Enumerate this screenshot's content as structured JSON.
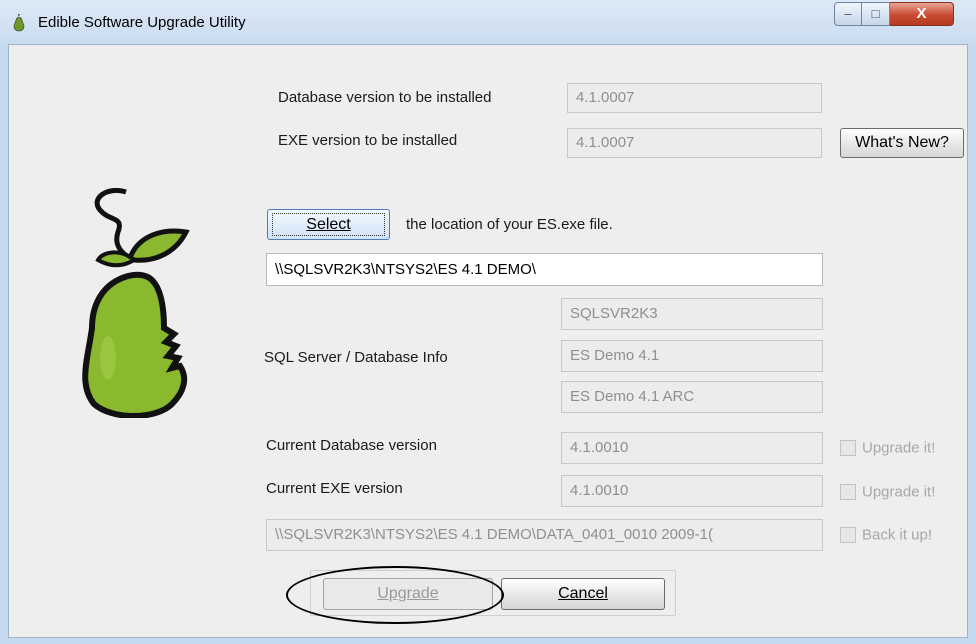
{
  "window": {
    "title": "Edible Software Upgrade Utility",
    "controls": {
      "minimize": "–",
      "maximize": "□",
      "close": "X"
    }
  },
  "versions": {
    "db_install_label": "Database version to be installed",
    "db_install_value": "4.1.0007",
    "exe_install_label": "EXE version to be installed",
    "exe_install_value": "4.1.0007",
    "whats_new_label": "What's New?"
  },
  "location": {
    "select_label": "Select",
    "select_hint": "the location of your ES.exe file.",
    "path_value": "\\\\SQLSVR2K3\\NTSYS2\\ES 4.1 DEMO\\"
  },
  "sql": {
    "label": "SQL Server / Database Info",
    "server": "SQLSVR2K3",
    "database": "ES Demo 4.1",
    "archive": "ES Demo 4.1 ARC"
  },
  "current": {
    "db_label": "Current Database version",
    "db_value": "4.1.0010",
    "db_check": "Upgrade it!",
    "exe_label": "Current EXE version",
    "exe_value": "4.1.0010",
    "exe_check": "Upgrade it!",
    "backup_path": "\\\\SQLSVR2K3\\NTSYS2\\ES 4.1 DEMO\\DATA_0401_0010 2009-1(",
    "backup_check": "Back it up!"
  },
  "buttons": {
    "upgrade": "Upgrade",
    "cancel": "Cancel"
  },
  "colors": {
    "pear_green": "#8ab82f",
    "window_frame": "#c4d8ee",
    "close_red": "#c84a30"
  },
  "icons": {
    "title": "pear-icon",
    "logo": "pear-logo"
  }
}
